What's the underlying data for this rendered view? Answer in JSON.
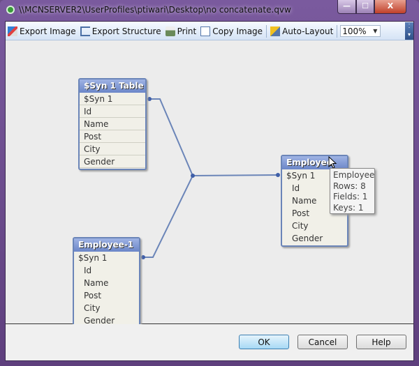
{
  "window": {
    "title": "\\\\MCNSERVER2\\UserProfiles\\ptiwari\\Desktop\\no concatenate.qvw",
    "minimize_icon": "minimize-icon",
    "maximize_icon": "maximize-icon",
    "close_icon": "close-icon"
  },
  "toolbar": {
    "export_image": "Export Image",
    "export_structure": "Export Structure",
    "print": "Print",
    "copy_image": "Copy Image",
    "auto_layout": "Auto-Layout",
    "zoom_value": "100%"
  },
  "tables": [
    {
      "title": "$Syn 1 Table",
      "fields": [
        "$Syn 1",
        "Id",
        "Name",
        "Post",
        "City",
        "Gender"
      ]
    },
    {
      "title": "Employee",
      "fields": [
        "$Syn 1",
        "Id",
        "Name",
        "Post",
        "City",
        "Gender"
      ]
    },
    {
      "title": "Employee-1",
      "fields": [
        "$Syn 1",
        "Id",
        "Name",
        "Post",
        "City",
        "Gender"
      ]
    }
  ],
  "tooltip": {
    "name": "Employee",
    "rows": "Rows: 8",
    "fields": "Fields: 1",
    "keys": "Keys: 1"
  },
  "buttons": {
    "ok": "OK",
    "cancel": "Cancel",
    "help": "Help"
  },
  "colors": {
    "table_header": "#7a93d0",
    "link": "#6b85b8",
    "frame": "#6a4c86"
  }
}
